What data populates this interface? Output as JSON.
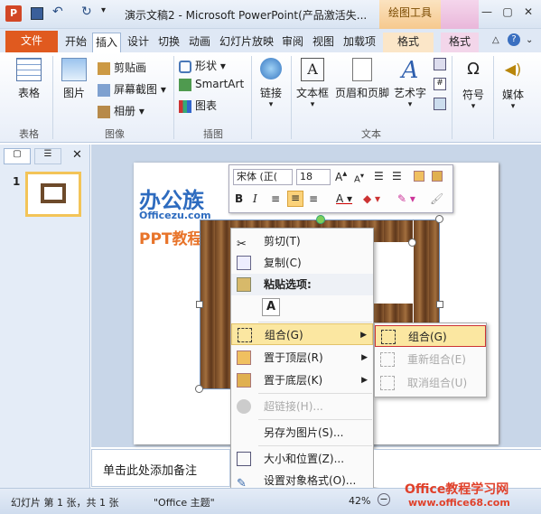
{
  "title_bar": {
    "title": "演示文稿2 - Microsoft PowerPoint(产品激活失...",
    "ctx_tab": "绘图工具"
  },
  "tabs": [
    "文件",
    "开始",
    "插入",
    "设计",
    "切换",
    "动画",
    "幻灯片放映",
    "审阅",
    "视图",
    "加载项",
    "格式",
    "格式"
  ],
  "ribbon": {
    "table": "表格",
    "picture": "图片",
    "clipart": "剪贴画",
    "screenshot": "屏幕截图",
    "album": "相册",
    "shapes": "形状",
    "smartart": "SmartArt",
    "chart": "图表",
    "link": "链接",
    "textbox": "文本框",
    "headerfooter": "页眉和页脚",
    "wordart": "艺术字",
    "symbol": "符号",
    "media": "媒体",
    "groups": {
      "table": "表格",
      "images": "图像",
      "illustrations": "插图",
      "text": "文本"
    }
  },
  "mini_toolbar": {
    "font": "宋体 (正(",
    "size": "18"
  },
  "watermark": {
    "logo": "办公族",
    "url": "Officezu.com",
    "tag": "PPT教程"
  },
  "context_menu": {
    "cut": "剪切(T)",
    "copy": "复制(C)",
    "paste_options": "粘贴选项:",
    "paste_a": "A",
    "group": "组合(G)",
    "bring_front": "置于顶层(R)",
    "send_back": "置于底层(K)",
    "hyperlink": "超链接(H)...",
    "save_as_picture": "另存为图片(S)...",
    "size_position": "大小和位置(Z)...",
    "format_shape": "设置对象格式(O)..."
  },
  "submenu": {
    "group": "组合(G)",
    "regroup": "重新组合(E)",
    "ungroup": "取消组合(U)"
  },
  "notes_placeholder": "单击此处添加备注",
  "thumbnail_number": "1",
  "status": {
    "slide": "幻灯片 第 1 张，共 1 张",
    "theme": "\"Office 主题\"",
    "zoom": "42%"
  },
  "site_watermark": {
    "brand": "Office教程学习网",
    "url": "www.office68.com"
  },
  "colors": {
    "file_tab": "#e05a1f",
    "ctx_orange": "#f6c98e",
    "highlight": "#fbe7a1"
  }
}
